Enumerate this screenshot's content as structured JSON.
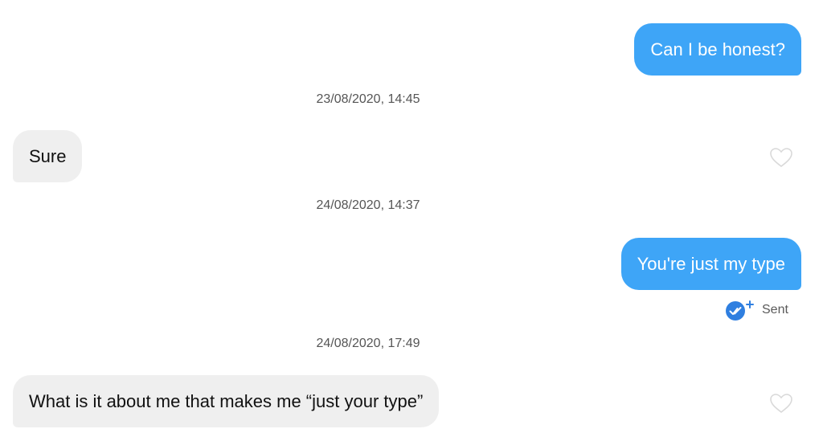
{
  "messages": [
    {
      "direction": "outgoing",
      "text": "Can I be honest?"
    },
    {
      "timestamp": "23/08/2020, 14:45"
    },
    {
      "direction": "incoming",
      "text": "Sure",
      "like_icon": "heart-outline-icon"
    },
    {
      "timestamp": "24/08/2020, 14:37"
    },
    {
      "direction": "outgoing",
      "text": "You're just my type",
      "status": "Sent",
      "status_icon": "double-check-plus-icon"
    },
    {
      "timestamp": "24/08/2020, 17:49"
    },
    {
      "direction": "incoming",
      "text": "What is it about me that makes me “just your type”",
      "like_icon": "heart-outline-icon"
    }
  ],
  "colors": {
    "outgoing_bubble": "#3ea5f7",
    "incoming_bubble": "#efefef",
    "read_receipt": "#2f7fe0",
    "heart_outline": "#d9d9d9"
  }
}
